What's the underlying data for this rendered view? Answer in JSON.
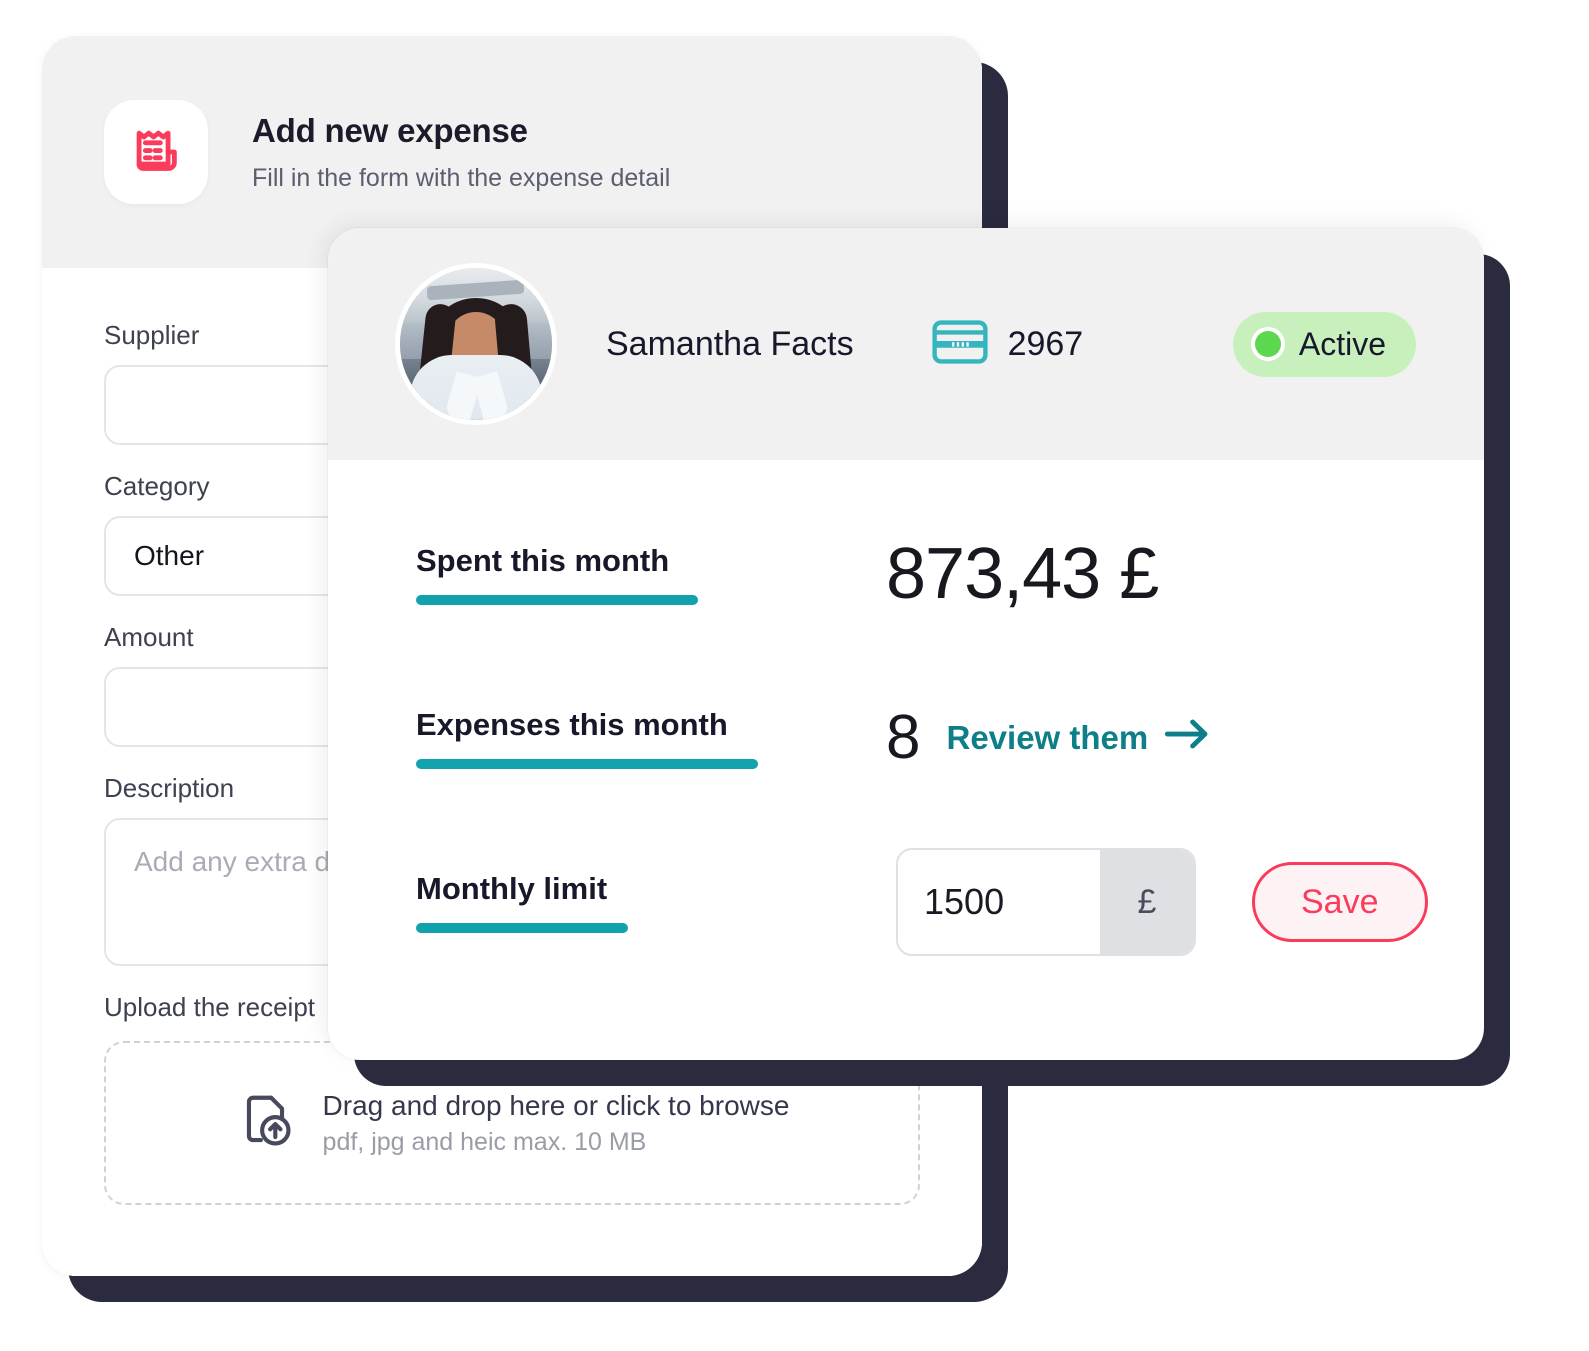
{
  "expense_form": {
    "icon": "receipt-icon",
    "title": "Add new expense",
    "subtitle": "Fill in the form with the expense detail",
    "fields": [
      {
        "label": "Supplier",
        "value": "",
        "placeholder": ""
      },
      {
        "label": "Category",
        "value": "Other",
        "placeholder": ""
      },
      {
        "label": "Amount",
        "value": "",
        "placeholder": ""
      },
      {
        "label": "Description",
        "value": "",
        "placeholder": "Add any extra detail"
      }
    ],
    "upload": {
      "label": "Upload the receipt",
      "icon": "file-upload-icon",
      "main_text": "Drag and drop here or click to browse",
      "sub_text": "pdf, jpg and heic max. 10 MB"
    }
  },
  "card_detail": {
    "header": {
      "avatar": "user-avatar",
      "holder_name": "Samantha Facts",
      "card_icon": "credit-card-icon",
      "card_number": "2967",
      "status": {
        "label": "Active",
        "dot": "status-dot-icon",
        "bg_color": "#c8f0bd",
        "dot_color": "#5bd750"
      }
    },
    "stats": {
      "spent": {
        "label": "Spent this month",
        "value": "873,43 £"
      },
      "expenses": {
        "label": "Expenses this month",
        "count": "8",
        "link_label": "Review them",
        "link_icon": "arrow-right-icon"
      },
      "limit": {
        "label": "Monthly limit",
        "value": "1500",
        "currency": "£",
        "save_label": "Save"
      }
    },
    "accent_color": "#12a2ad",
    "link_color": "#0e7f88",
    "save_color": "#fb3b5c"
  }
}
